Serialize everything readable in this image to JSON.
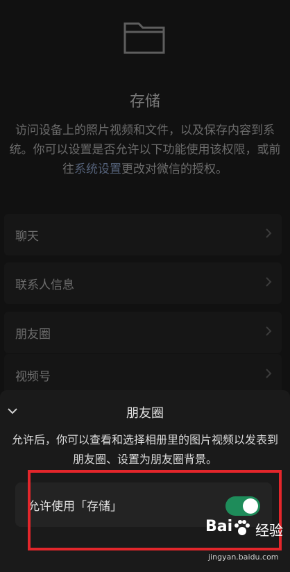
{
  "header": {
    "icon": "folder-icon",
    "title": "存储",
    "desc_before": "访问设备上的照片视频和文件，以及保存内容到系统。你可以设置是否允许以下功能使用该权限，或前往",
    "desc_link": "系统设置",
    "desc_after": "更改对微信的授权。"
  },
  "list": {
    "items": [
      {
        "label": "聊天"
      },
      {
        "label": "联系人信息"
      },
      {
        "label": "朋友圈"
      },
      {
        "label": "视频号"
      }
    ]
  },
  "sheet": {
    "title": "朋友圈",
    "description": "允许后，你可以查看和选择相册里的图片视频以发表到朋友圈、设置为朋友圈背景。",
    "toggle_label": "允许使用「存储」",
    "toggle_on": true
  },
  "colors": {
    "toggle_on": "#1e8c5a",
    "highlight": "#e3262b"
  },
  "watermark": {
    "logo": "Bai",
    "logo_suffix": "经验",
    "url": "jingyan.baidu.com"
  }
}
